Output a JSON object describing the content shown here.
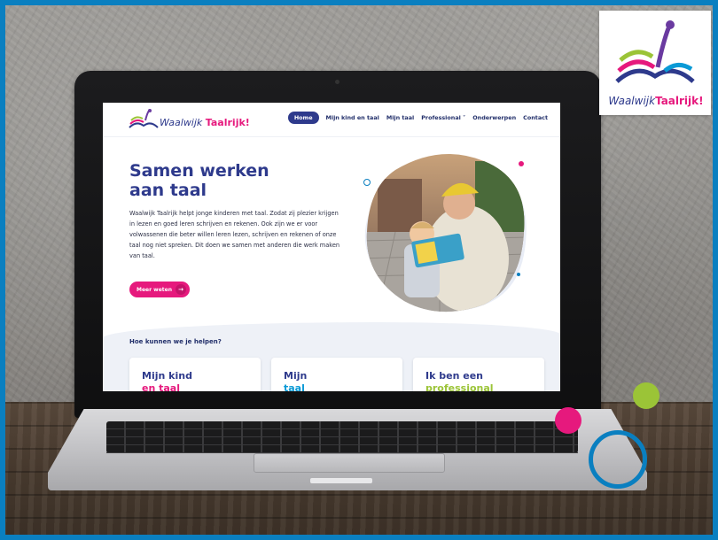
{
  "website": {
    "logo": {
      "part1": "Waalwijk",
      "part2": "Taalrijk!"
    },
    "nav": [
      {
        "label": "Home",
        "active": true
      },
      {
        "label": "Mijn kind en taal",
        "active": false
      },
      {
        "label": "Mijn taal",
        "active": false
      },
      {
        "label": "Professional ˅",
        "active": false
      },
      {
        "label": "Onderwerpen",
        "active": false
      },
      {
        "label": "Contact",
        "active": false
      }
    ],
    "hero": {
      "title_line1": "Samen werken",
      "title_line2": "aan taal",
      "body": "Waalwijk Taalrijk helpt jonge kinderen met taal. Zodat zij plezier krijgen in lezen en goed leren schrijven en rekenen. Ook zijn we er voor volwassenen die beter willen leren lezen, schrijven en rekenen of onze taal nog niet spreken. Dit doen we samen met anderen die werk maken van taal.",
      "cta_label": "Meer weten",
      "cta_arrow": "→"
    },
    "help": {
      "title": "Hoe kunnen we je helpen?",
      "cards": [
        {
          "line1": "Mijn kind",
          "line2": "en taal",
          "color": "#e6197d"
        },
        {
          "line1": "Mijn",
          "line2": "taal",
          "color": "#0a9ad6"
        },
        {
          "line1": "Ik ben een",
          "line2": "professional",
          "color": "#9bc437"
        }
      ]
    }
  },
  "badge": {
    "part1": "Waalwijk",
    "part2": "Taalrijk!"
  },
  "colors": {
    "brand_navy": "#2e3a8c",
    "brand_pink": "#e6197d",
    "brand_green": "#9bc437",
    "brand_blue": "#0a7fc0",
    "frame": "#0a7fc0"
  },
  "icons": [
    "book-logo-icon",
    "arrow-right-icon",
    "chevron-down-icon"
  ]
}
